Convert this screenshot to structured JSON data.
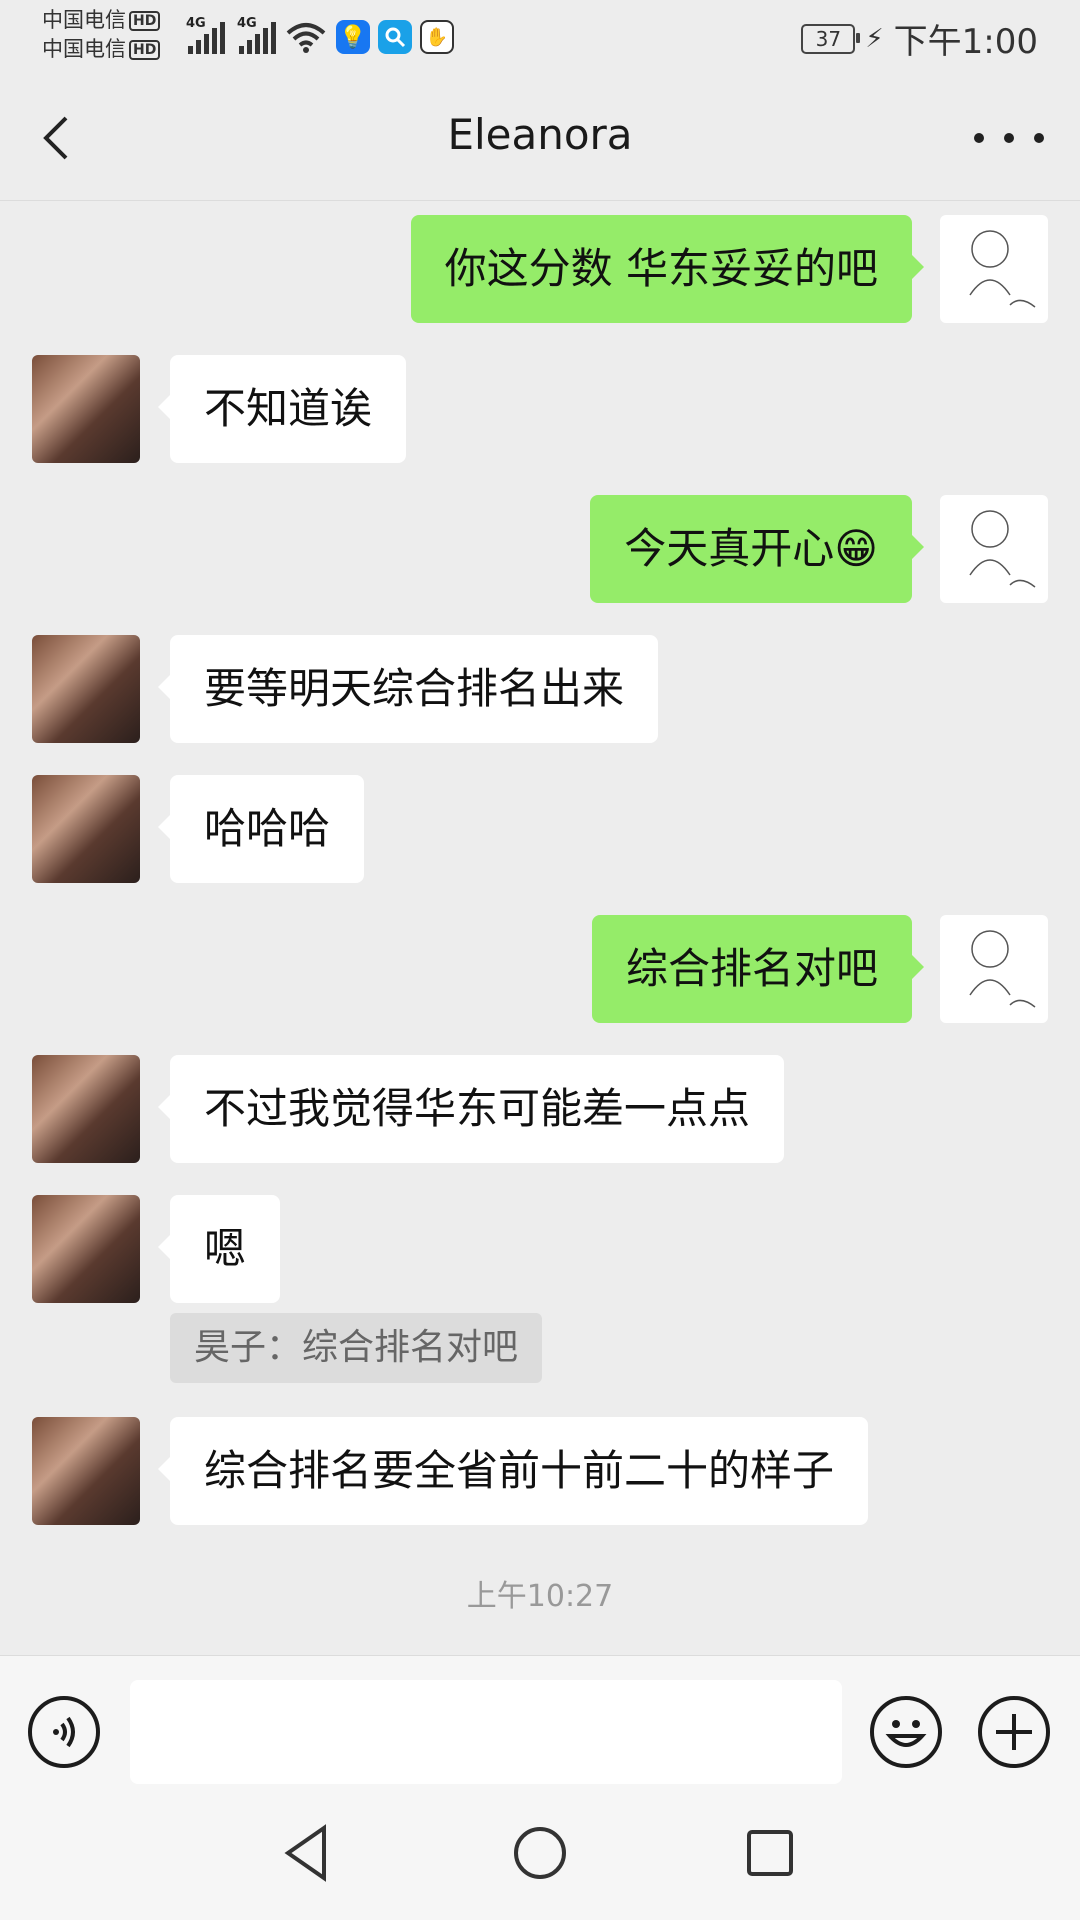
{
  "status": {
    "carrier1": "中国电信",
    "carrier2": "中国电信",
    "hd_badge": "HD",
    "net1": "4G",
    "net2": "4G",
    "battery": "37",
    "time": "下午1:00"
  },
  "header": {
    "title": "Eleanora"
  },
  "messages": [
    {
      "side": "right",
      "text": "你这分数 华东妥妥的吧"
    },
    {
      "side": "left",
      "text": "不知道诶"
    },
    {
      "side": "right",
      "text": "今天真开心😁"
    },
    {
      "side": "left",
      "text": "要等明天综合排名出来"
    },
    {
      "side": "left",
      "text": "哈哈哈"
    },
    {
      "side": "right",
      "text": "综合排名对吧"
    },
    {
      "side": "left",
      "text": "不过我觉得华东可能差一点点"
    },
    {
      "side": "left",
      "text": "嗯"
    },
    {
      "side": "left",
      "text": "综合排名要全省前十前二十的样子"
    }
  ],
  "quote": {
    "text": "昊子：综合排名对吧"
  },
  "timestamp": "上午10:27",
  "input": {
    "placeholder": ""
  },
  "colors": {
    "sent_bubble": "#95ec69",
    "received_bubble": "#ffffff",
    "background": "#ededed"
  }
}
